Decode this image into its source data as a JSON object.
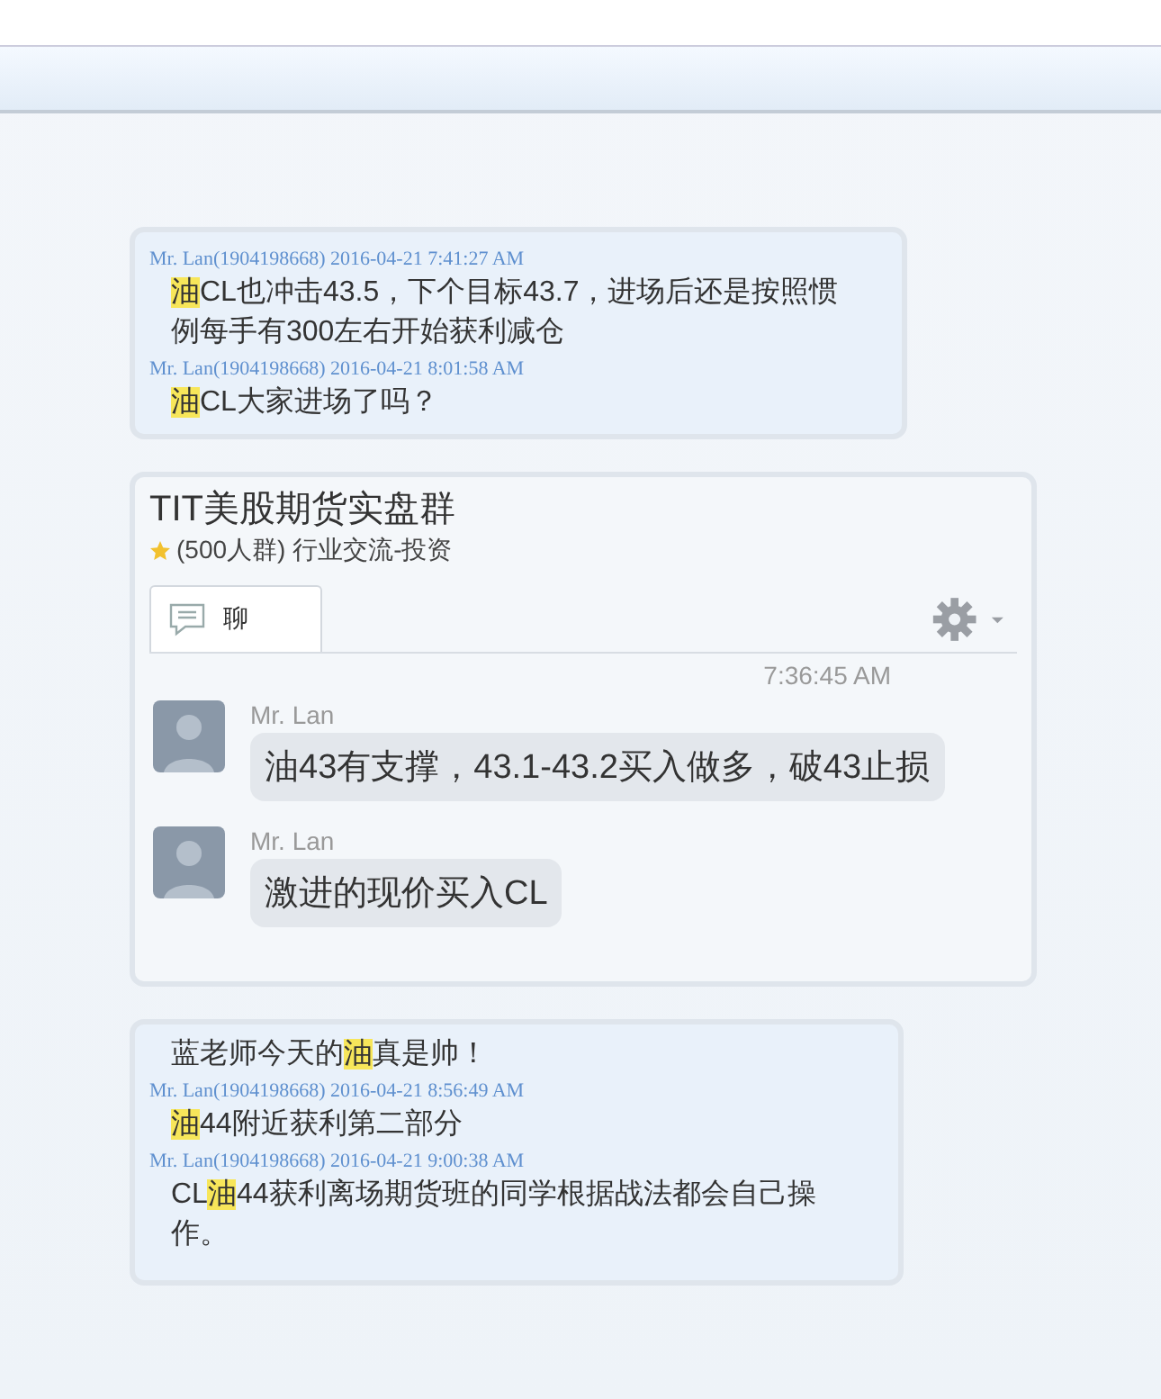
{
  "top_card": {
    "messages": [
      {
        "meta": "Mr. Lan(1904198668) 2016-04-21 7:41:27 AM",
        "text": "**油**CL也冲击43.5，下个目标43.7，进场后还是按照惯例每手有300左右开始获利减仓"
      },
      {
        "meta": "Mr. Lan(1904198668) 2016-04-21 8:01:58 AM",
        "text": "**油**CL大家进场了吗？"
      }
    ]
  },
  "group": {
    "title": "TIT美股期货实盘群",
    "info": "(500人群) 行业交流-投资",
    "tab": "聊",
    "time": "7:36:45 AM",
    "messages": [
      {
        "sender": "Mr. Lan",
        "text": "油43有支撑，43.1-43.2买入做多，破43止损"
      },
      {
        "sender": "Mr. Lan",
        "text": "激进的现价买入CL"
      }
    ]
  },
  "bottom_card": {
    "messages": [
      {
        "text": "蓝老师今天的**油**真是帅！"
      },
      {
        "meta": "Mr. Lan(1904198668) 2016-04-21 8:56:49 AM",
        "text": "**油**44附近获利第二部分"
      },
      {
        "meta": "Mr. Lan(1904198668) 2016-04-21 9:00:38 AM",
        "text": "CL**油**44获利离场期货班的同学根据战法都会自己操作。"
      }
    ]
  }
}
